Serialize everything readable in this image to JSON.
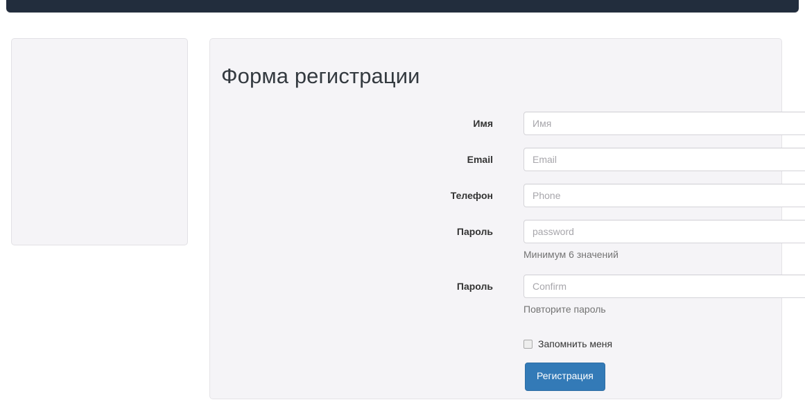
{
  "navbar": {
    "background": "#222d3d"
  },
  "side_panel": {
    "background": "#f5f4f7",
    "border": "#e2e1e5"
  },
  "form_panel": {
    "title": "Форма регистрации",
    "background": "#f5f4f7",
    "fields": [
      {
        "label": "Имя",
        "placeholder": "Имя",
        "value": "",
        "type": "text",
        "help": ""
      },
      {
        "label": "Email",
        "placeholder": "Email",
        "value": "",
        "type": "email",
        "help": ""
      },
      {
        "label": "Телефон",
        "placeholder": "Phone",
        "value": "",
        "type": "tel",
        "help": ""
      },
      {
        "label": "Пароль",
        "placeholder": "password",
        "value": "",
        "type": "password",
        "help": "Минимум 6 значений"
      },
      {
        "label": "Пароль",
        "placeholder": "Confirm",
        "value": "",
        "type": "password",
        "help": "Повторите пароль"
      }
    ],
    "remember": {
      "label": "Запомнить меня",
      "checked": false
    },
    "submit": {
      "label": "Регистрация",
      "color": "#337ab7",
      "border_color": "#2e6da4"
    }
  }
}
